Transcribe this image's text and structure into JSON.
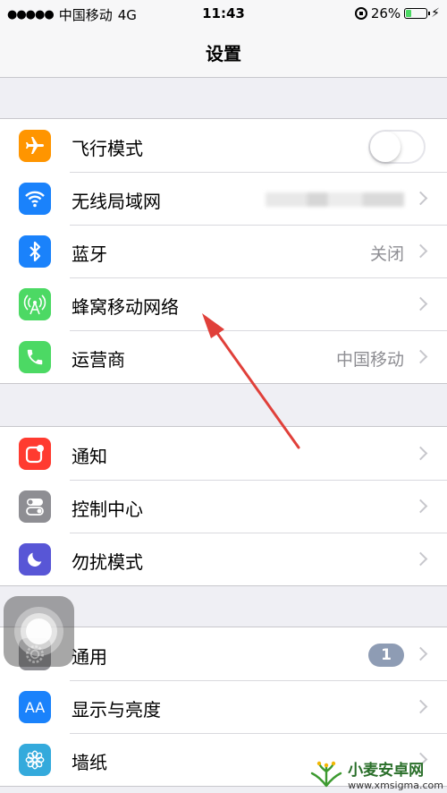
{
  "status_bar": {
    "signal": "●●●●●",
    "carrier": "中国移动",
    "network": "4G",
    "time": "11:43",
    "battery_percent": "26%",
    "battery_level": 0.26
  },
  "nav": {
    "title": "设置"
  },
  "group1": {
    "airplane": {
      "label": "飞行模式",
      "icon": "airplane-icon",
      "color": "#ff9500",
      "toggle_on": false
    },
    "wifi": {
      "label": "无线局域网",
      "icon": "wifi-icon",
      "color": "#1a82fb"
    },
    "bluetooth": {
      "label": "蓝牙",
      "value": "关闭",
      "icon": "bluetooth-icon",
      "color": "#1a82fb"
    },
    "cellular": {
      "label": "蜂窝移动网络",
      "icon": "cellular-antenna-icon",
      "color": "#4cd964"
    },
    "carrier": {
      "label": "运营商",
      "value": "中国移动",
      "icon": "phone-icon",
      "color": "#4cd964"
    }
  },
  "group2": {
    "notifications": {
      "label": "通知",
      "icon": "notifications-icon",
      "color": "#ff3b30"
    },
    "control_center": {
      "label": "控制中心",
      "icon": "control-center-icon",
      "color": "#8e8e93"
    },
    "dnd": {
      "label": "勿扰模式",
      "icon": "moon-icon",
      "color": "#5856d6"
    }
  },
  "group3": {
    "general": {
      "label": "通用",
      "badge": "1",
      "icon": "gear-icon",
      "color": "#8e8e93"
    },
    "display": {
      "label": "显示与亮度",
      "icon": "text-size-icon",
      "color": "#1a82fb"
    },
    "wallpaper": {
      "label": "墙纸",
      "icon": "flower-icon",
      "color": "#34aadc"
    }
  },
  "watermark": {
    "name": "小麦安卓网",
    "url": "www.xmsigma.com"
  },
  "colors": {
    "background": "#efeff4",
    "separator": "#c8c7cc",
    "secondary_text": "#8e8e93",
    "arrow": "#e0403a"
  }
}
